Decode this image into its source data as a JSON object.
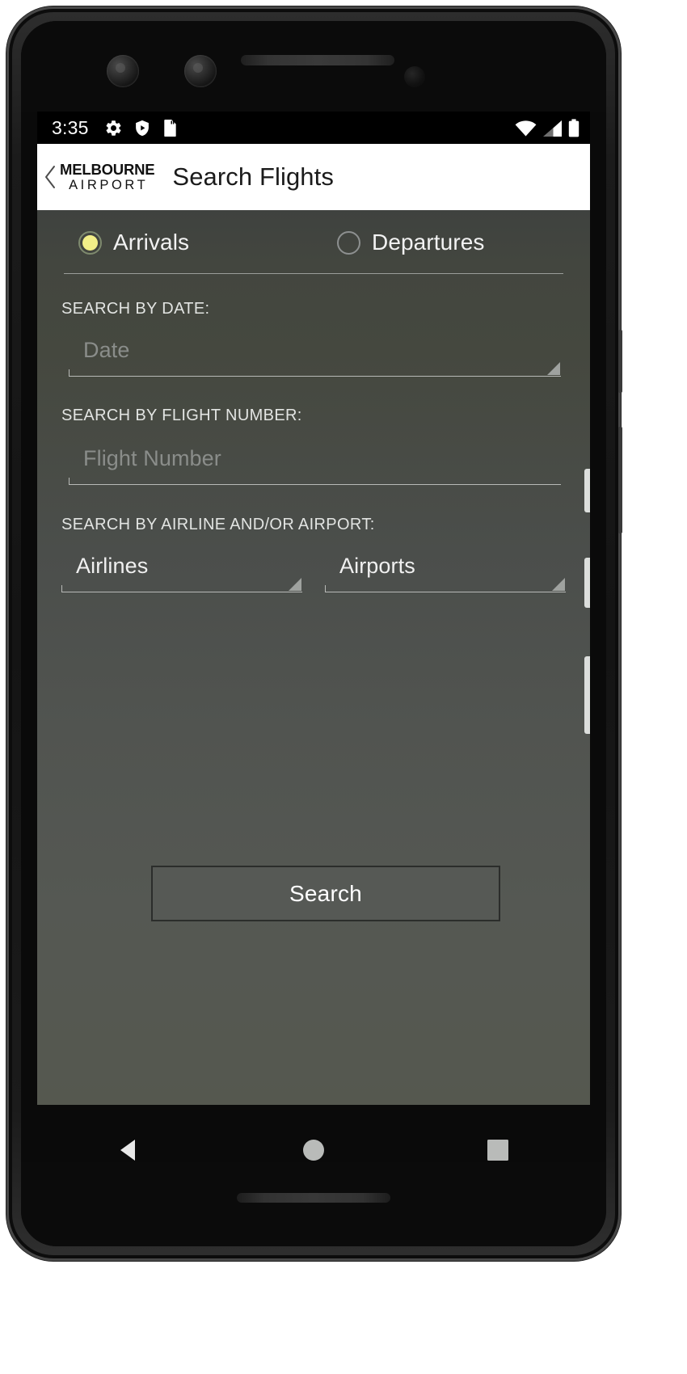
{
  "status_bar": {
    "time": "3:35",
    "left_icons": [
      "gear-icon",
      "shield-play-icon",
      "sd-card-icon"
    ],
    "right_icons": [
      "wifi-icon",
      "cell-signal-icon",
      "battery-icon"
    ]
  },
  "app_bar": {
    "back_icon": "back-chevron-icon",
    "brand_line1": "MELBOURNE",
    "brand_line2": "AIRPORT",
    "title": "Search Flights"
  },
  "segment": {
    "arrivals_label": "Arrivals",
    "departures_label": "Departures",
    "selected": "Arrivals",
    "selected_dot_color": "#f2ef88"
  },
  "fields": {
    "date": {
      "label": "SEARCH BY DATE:",
      "placeholder": "Date",
      "value": "",
      "type": "spinner"
    },
    "flight_number": {
      "label": "SEARCH BY FLIGHT NUMBER:",
      "placeholder": "Flight Number",
      "value": "",
      "type": "text"
    },
    "airline_airport": {
      "label": "SEARCH BY AIRLINE AND/OR AIRPORT:",
      "airlines_value": "Airlines",
      "airports_value": "Airports",
      "type": "spinner"
    }
  },
  "actions": {
    "search_label": "Search"
  },
  "nav_bar": {
    "back_icon": "nav-back-triangle-icon",
    "home_icon": "nav-home-circle-icon",
    "recents_icon": "nav-recents-square-icon"
  },
  "colors": {
    "accent_yellow": "#f2ef88",
    "app_bar_bg": "#ffffff",
    "content_bg": "#4a4d4b",
    "status_bar_bg": "#000000"
  }
}
